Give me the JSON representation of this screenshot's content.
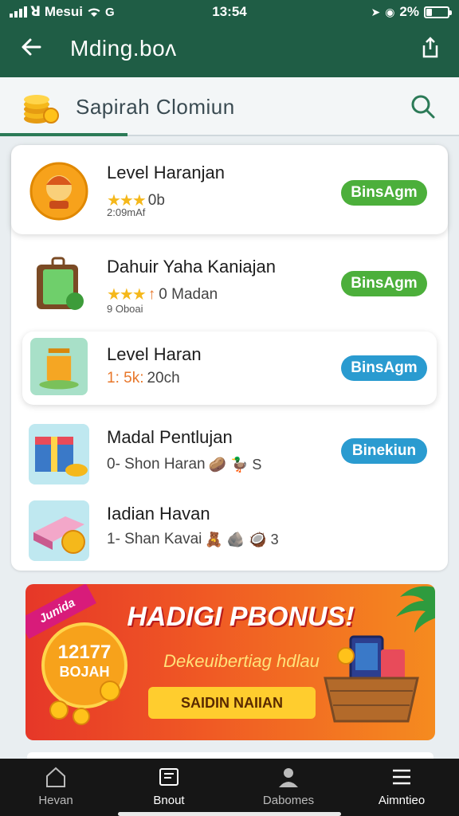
{
  "status_bar": {
    "carrier": "ꓤ Mesui",
    "time": "13:54",
    "battery": "2%",
    "battery_level": 0.25
  },
  "app_bar": {
    "title": "Mding.boᴧ"
  },
  "search": {
    "label": "Sapirah Clomiun"
  },
  "items": [
    {
      "title": "Level Haranjan",
      "rating": "★★★",
      "rating_text": "0b",
      "sub": "2:09mAf",
      "action": "BinsAgm",
      "action_color": "#4caf3b"
    },
    {
      "title": "Dahuir Yaha Kaniajan",
      "rating": "★★★",
      "rating_text": "0 Madan",
      "rating_prefix": "↑",
      "sub": "9 Oboai",
      "action": "BinsAgm",
      "action_color": "#4caf3b"
    },
    {
      "title": "Level Haran",
      "rating_text": "20ch",
      "highlight": "1: 5k:",
      "action": "BinsAgm",
      "action_color": "#2a9bd0"
    },
    {
      "title": "Madal Pentlujan",
      "rating_text": "0- Shon Haran",
      "icons": "🥔 🦆 S",
      "action": "Binekiun",
      "action_color": "#2a9bd0"
    },
    {
      "title": "Iadian Havan",
      "rating_text": "1- Shan Kavai",
      "icons": "🧸 🪨 🥥 3"
    }
  ],
  "banner": {
    "ribbon": "Junida",
    "badge_top": "12177",
    "badge_bottom": "BOJAH",
    "headline": "HADIGI PBONUS!",
    "tagline": "Dekeuibertiag hdlau",
    "cta": "SAIDIN NAIIAN"
  },
  "bottom_nav": [
    {
      "label": "Hevan"
    },
    {
      "label": "Bnout"
    },
    {
      "label": "Dabomes"
    },
    {
      "label": "Aimntieo"
    }
  ],
  "colors": {
    "header": "#1f5d45",
    "accent_green": "#4caf3b",
    "accent_blue": "#2a9bd0",
    "nav_bg": "#161616"
  }
}
